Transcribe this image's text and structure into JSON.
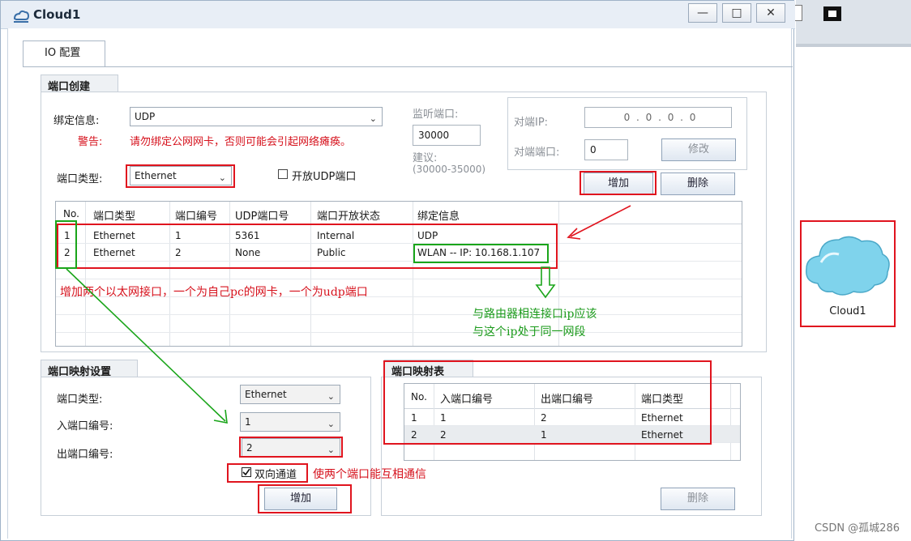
{
  "window": {
    "title": "Cloud1"
  },
  "tab": {
    "label": "IO 配置"
  },
  "port_create": {
    "group_title": "端口创建",
    "bind_label": "绑定信息:",
    "bind_value": "UDP",
    "warn_label": "警告:",
    "warn_text": "请勿绑定公网网卡，否则可能会引起网络瘫痪。",
    "port_type_label": "端口类型:",
    "port_type_value": "Ethernet",
    "open_udp_label": "开放UDP端口",
    "listen_label": "监听端口:",
    "listen_value": "30000",
    "suggest_label": "建议:",
    "suggest_range": "(30000-35000)",
    "peer_ip_label": "对端IP:",
    "peer_ip_value": "0 . 0 . 0 . 0",
    "peer_port_label": "对端端口:",
    "peer_port_value": "0",
    "modify_label": "修改",
    "add_label": "增加",
    "delete_label": "删除",
    "table": {
      "headers": [
        "No.",
        "端口类型",
        "端口编号",
        "UDP端口号",
        "端口开放状态",
        "绑定信息"
      ],
      "rows": [
        [
          "1",
          "Ethernet",
          "1",
          "5361",
          "Internal",
          "UDP"
        ],
        [
          "2",
          "Ethernet",
          "2",
          "None",
          "Public",
          "WLAN -- IP: 10.168.1.107"
        ]
      ]
    }
  },
  "port_map_settings": {
    "group_title": "端口映射设置",
    "port_type_label": "端口类型:",
    "port_type_value": "Ethernet",
    "in_port_label": "入端口编号:",
    "in_port_value": "1",
    "out_port_label": "出端口编号:",
    "out_port_value": "2",
    "bidirectional_label": "双向通道",
    "add_label": "增加"
  },
  "port_map_table": {
    "group_title": "端口映射表",
    "headers": [
      "No.",
      "入端口编号",
      "出端口编号",
      "端口类型"
    ],
    "rows": [
      [
        "1",
        "1",
        "2",
        "Ethernet"
      ],
      [
        "2",
        "2",
        "1",
        "Ethernet"
      ]
    ],
    "delete_label": "删除"
  },
  "annotations": {
    "red_note_1": "增加两个以太网接口，一个为自己pc的网卡，一个为udp端口",
    "green_note_line1": "与路由器相连接口ip应该",
    "green_note_line2": "与这个ip处于同一网段",
    "red_note_2": "使两个端口能互相通信"
  },
  "cloud_device": {
    "label": "Cloud1"
  },
  "watermark": "CSDN @孤城286",
  "colors": {
    "annotation_red": "#e0141e",
    "annotation_green": "#1aa51a",
    "cloud": "#7fd3ec"
  }
}
